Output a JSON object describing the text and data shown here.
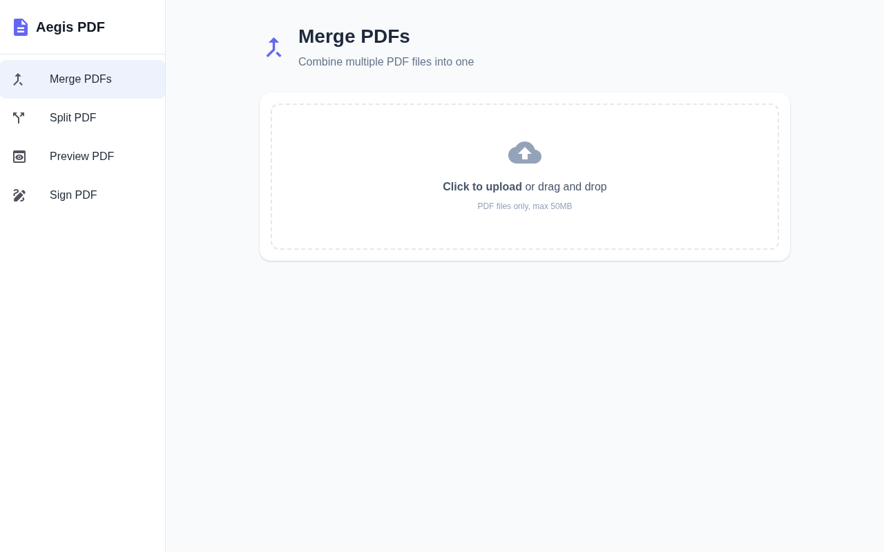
{
  "app": {
    "name": "Aegis PDF"
  },
  "sidebar": {
    "items": [
      {
        "label": "Merge PDFs",
        "kind": "merge",
        "selected": true
      },
      {
        "label": "Split PDF",
        "kind": "split",
        "selected": false
      },
      {
        "label": "Preview PDF",
        "kind": "preview",
        "selected": false
      },
      {
        "label": "Sign PDF",
        "kind": "sign",
        "selected": false
      }
    ]
  },
  "header": {
    "title": "Merge PDFs",
    "subtitle": "Combine multiple PDF files into one"
  },
  "upload": {
    "prompt": "**Click to upload** or drag and drop",
    "hint": "PDF files only, max 50MB"
  }
}
